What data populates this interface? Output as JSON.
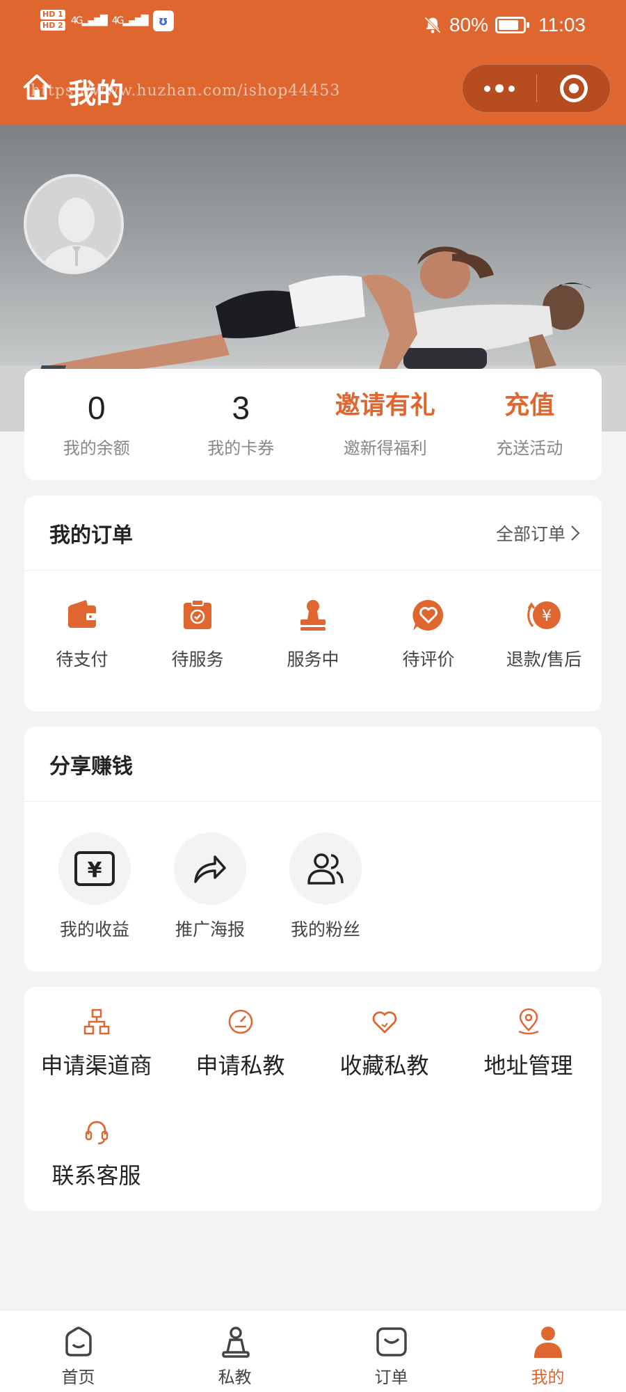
{
  "status_bar": {
    "hd1": "HD 1",
    "hd2": "HD 2",
    "net1": "4G",
    "net2": "4G",
    "battery": "80%",
    "time": "11:03"
  },
  "header": {
    "title": "我的",
    "watermark": "https://www.huzhan.com/ishop44453"
  },
  "stats": [
    {
      "value": "0",
      "label": "我的余额"
    },
    {
      "value": "3",
      "label": "我的卡券"
    },
    {
      "value": "邀请有礼",
      "label": "邀新得福利"
    },
    {
      "value": "充值",
      "label": "充送活动"
    }
  ],
  "orders": {
    "title": "我的订单",
    "all_label": "全部订单",
    "items": [
      {
        "label": "待支付",
        "icon": "wallet-icon"
      },
      {
        "label": "待服务",
        "icon": "clipboard-check-icon"
      },
      {
        "label": "服务中",
        "icon": "stamp-icon"
      },
      {
        "label": "待评价",
        "icon": "heart-chat-icon"
      },
      {
        "label": "退款/售后",
        "icon": "refund-yen-icon"
      }
    ]
  },
  "share": {
    "title": "分享赚钱",
    "items": [
      {
        "label": "我的收益",
        "icon": "yen-wallet-icon"
      },
      {
        "label": "推广海报",
        "icon": "share-arrow-icon"
      },
      {
        "label": "我的粉丝",
        "icon": "users-icon"
      }
    ]
  },
  "tools": [
    {
      "label": "申请渠道商",
      "icon": "hierarchy-icon"
    },
    {
      "label": "申请私教",
      "icon": "gauge-icon"
    },
    {
      "label": "收藏私教",
      "icon": "heart-icon"
    },
    {
      "label": "地址管理",
      "icon": "location-pin-icon"
    },
    {
      "label": "联系客服",
      "icon": "headset-icon"
    }
  ],
  "tabbar": [
    {
      "label": "首页",
      "icon": "home-icon",
      "active": false
    },
    {
      "label": "私教",
      "icon": "trainer-icon",
      "active": false
    },
    {
      "label": "订单",
      "icon": "order-bag-icon",
      "active": false
    },
    {
      "label": "我的",
      "icon": "person-icon",
      "active": true
    }
  ],
  "colors": {
    "accent": "#e0662f",
    "background": "#f3f3f5",
    "card": "#ffffff"
  }
}
